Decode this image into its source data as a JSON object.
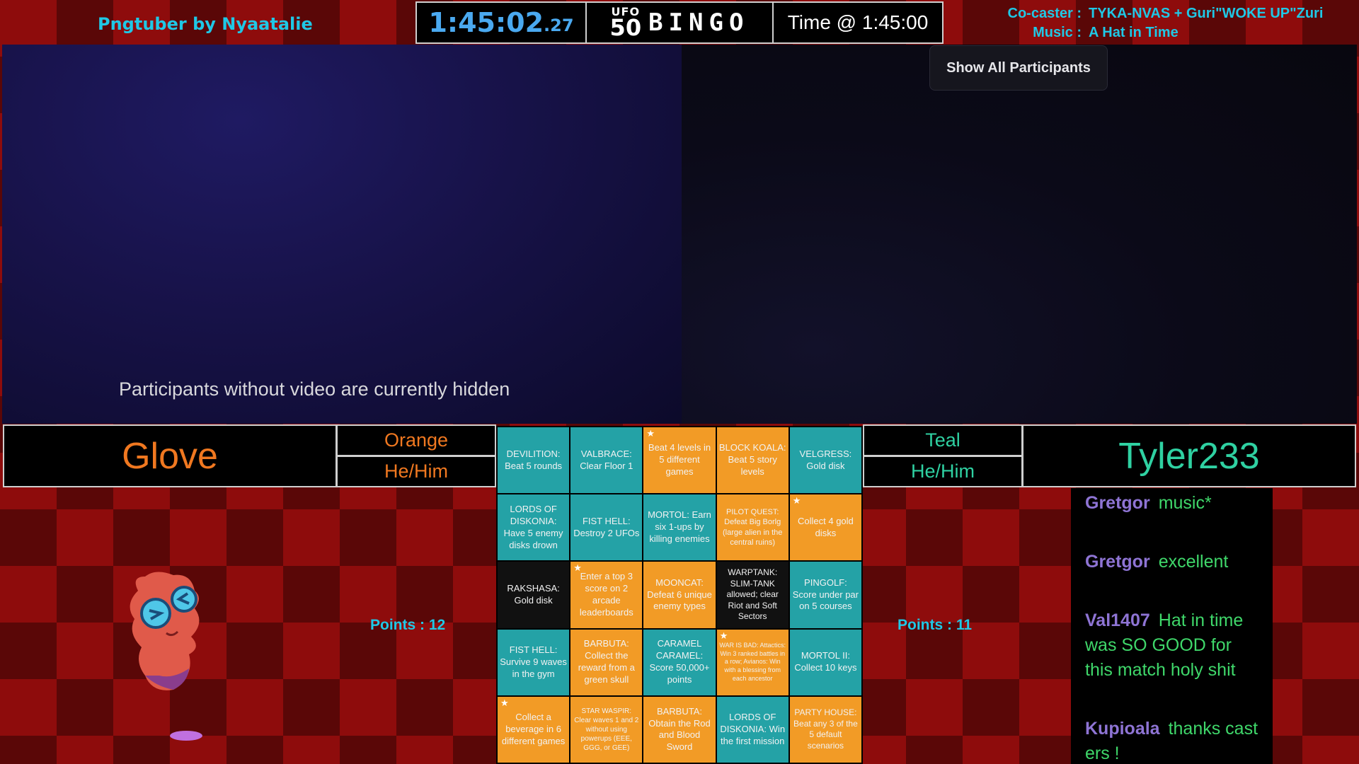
{
  "header": {
    "pngtuber_credit": "Pngtuber by Nyaatalie",
    "timer_main": "1:45:02",
    "timer_ms": ".27",
    "logo_top": "UFO",
    "logo_num": "50",
    "logo_word": "BINGO",
    "time_at": "Time @ 1:45:00"
  },
  "casters": {
    "cocaster_label": "Co-caster :",
    "cocaster_value": "TYKA-NVAS + Guri\"WOKE UP\"Zuri",
    "music_label": "Music :",
    "music_value": "A Hat in Time"
  },
  "video": {
    "hidden_message": "Participants without video are currently hidden",
    "show_all_button": "Show All Participants"
  },
  "players": {
    "left": {
      "name": "Glove",
      "color": "Orange",
      "pronouns": "He/Him",
      "points": "Points : 12"
    },
    "right": {
      "name": "Tyler233",
      "color": "Teal",
      "pronouns": "He/Him",
      "points": "Points : 11"
    }
  },
  "colors": {
    "orange": "#f29b26",
    "teal": "#24a2a6",
    "cyan_text": "#1fc8e6",
    "chat_user": "#8e74d4",
    "chat_text": "#3fd76a"
  },
  "board": [
    {
      "text": "DEVILITION: Beat 5 rounds",
      "color": "teal",
      "star": false,
      "size": 13
    },
    {
      "text": "VALBRACE: Clear Floor 1",
      "color": "teal",
      "star": false,
      "size": 13
    },
    {
      "text": "Beat 4 levels in 5 different games",
      "color": "orange",
      "star": true,
      "size": 13
    },
    {
      "text": "BLOCK KOALA: Beat 5 story levels",
      "color": "orange",
      "star": false,
      "size": 13
    },
    {
      "text": "VELGRESS: Gold disk",
      "color": "teal",
      "star": false,
      "size": 13
    },
    {
      "text": "LORDS OF DISKONIA: Have 5 enemy disks drown",
      "color": "teal",
      "star": false,
      "size": 13
    },
    {
      "text": "FIST HELL: Destroy 2 UFOs",
      "color": "teal",
      "star": false,
      "size": 13
    },
    {
      "text": "MORTOL: Earn six 1-ups by killing enemies",
      "color": "teal",
      "star": false,
      "size": 13
    },
    {
      "text": "PILOT QUEST: Defeat Big Borlg (large alien in the central ruins)",
      "color": "orange",
      "star": false,
      "size": 11
    },
    {
      "text": "Collect 4 gold disks",
      "color": "orange",
      "star": true,
      "size": 13
    },
    {
      "text": "RAKSHASA: Gold disk",
      "color": "black",
      "star": false,
      "size": 13
    },
    {
      "text": "Enter a top 3 score on 2 arcade leaderboards",
      "color": "orange",
      "star": true,
      "size": 13
    },
    {
      "text": "MOONCAT: Defeat 6 unique enemy types",
      "color": "orange",
      "star": false,
      "size": 13
    },
    {
      "text": "WARPTANK: SLIM-TANK allowed; clear Riot and Soft Sectors",
      "color": "black",
      "star": false,
      "size": 12
    },
    {
      "text": "PINGOLF: Score under par on 5 courses",
      "color": "teal",
      "star": false,
      "size": 13
    },
    {
      "text": "FIST HELL: Survive 9 waves in the gym",
      "color": "teal",
      "star": false,
      "size": 13
    },
    {
      "text": "BARBUTA: Collect the reward from a green skull",
      "color": "orange",
      "star": false,
      "size": 13
    },
    {
      "text": "CARAMEL CARAMEL: Score 50,000+ points",
      "color": "teal",
      "star": false,
      "size": 13
    },
    {
      "text": "WAR IS BAD: Attactics: Win 3 ranked battles in a row; Avianos: Win with a blessing from each ancestor",
      "color": "orange",
      "star": true,
      "size": 9
    },
    {
      "text": "MORTOL II: Collect 10 keys",
      "color": "teal",
      "star": false,
      "size": 13
    },
    {
      "text": "Collect a beverage in 6 different games",
      "color": "orange",
      "star": true,
      "size": 13
    },
    {
      "text": "STAR WASPIR: Clear waves 1 and 2 without using powerups (EEE, GGG, or GEE)",
      "color": "orange",
      "star": false,
      "size": 10
    },
    {
      "text": "BARBUTA: Obtain the Rod and Blood Sword",
      "color": "orange",
      "star": false,
      "size": 13
    },
    {
      "text": "LORDS OF DISKONIA: Win the first mission",
      "color": "teal",
      "star": false,
      "size": 13
    },
    {
      "text": "PARTY HOUSE: Beat any 3 of the 5 default scenarios",
      "color": "orange",
      "star": false,
      "size": 12
    }
  ],
  "chat": [
    {
      "user": "Gretgor",
      "text": "music*"
    },
    {
      "user": "Gretgor",
      "text": "excellent"
    },
    {
      "user": "Val1407",
      "text": "Hat in time was SO GOOD for this match holy shit"
    },
    {
      "user": "Kupioala",
      "text": "thanks cast ers !"
    }
  ]
}
